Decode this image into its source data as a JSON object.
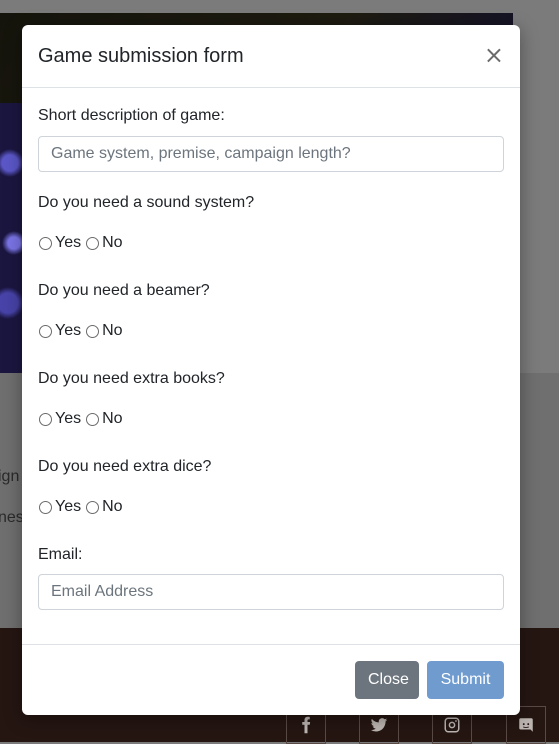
{
  "background": {
    "text_lines": [
      "ign",
      "nes"
    ],
    "social_icons": [
      "facebook-icon",
      "twitter-icon",
      "instagram-icon",
      "discord-icon"
    ]
  },
  "modal": {
    "title": "Game submission form",
    "close_symbol": "×",
    "description_label": "Short description of game:",
    "description_placeholder": "Game system, premise, campaign length?",
    "questions": [
      {
        "label": "Do you need a sound system?",
        "yes": "Yes",
        "no": "No"
      },
      {
        "label": "Do you need a beamer?",
        "yes": "Yes",
        "no": "No"
      },
      {
        "label": "Do you need extra books?",
        "yes": "Yes",
        "no": "No"
      },
      {
        "label": "Do you need extra dice?",
        "yes": "Yes",
        "no": "No"
      }
    ],
    "email_label": "Email:",
    "email_placeholder": "Email Address",
    "close_button": "Close",
    "submit_button": "Submit",
    "colors": {
      "submit": "#6f9bcf",
      "close": "#6c757d"
    }
  }
}
